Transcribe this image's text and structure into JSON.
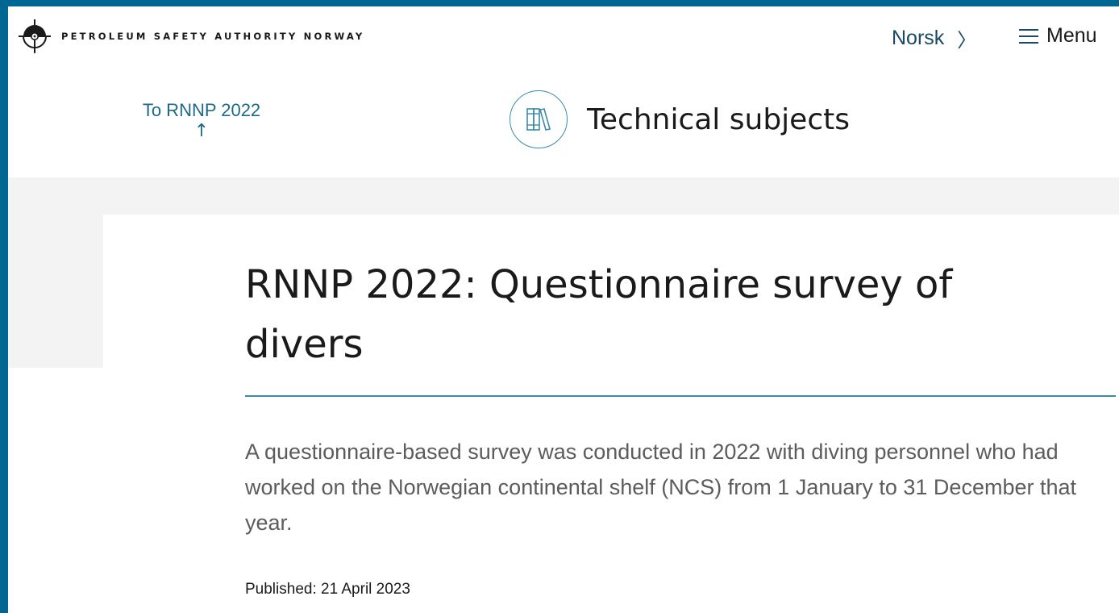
{
  "header": {
    "logo_text": "PETROLEUM SAFETY AUTHORITY NORWAY",
    "language_link": "Norsk",
    "menu_label": "Menu"
  },
  "breadcrumb": {
    "back_label": "To RNNP 2022",
    "back_arrow": "↑"
  },
  "subject": {
    "icon": "books-icon",
    "title": "Technical subjects"
  },
  "article": {
    "title": "RNNP 2022: Questionnaire survey of divers",
    "lead": "A questionnaire-based survey was conducted in 2022 with diving personnel who had worked on the Norwegian continental shelf (NCS) from 1 January to 31 December that year.",
    "published": "Published: 21 April 2023"
  },
  "colors": {
    "frame": "#006792",
    "accent": "#3b8aa8",
    "link": "#1e6a86",
    "band": "#f3f3f3"
  }
}
